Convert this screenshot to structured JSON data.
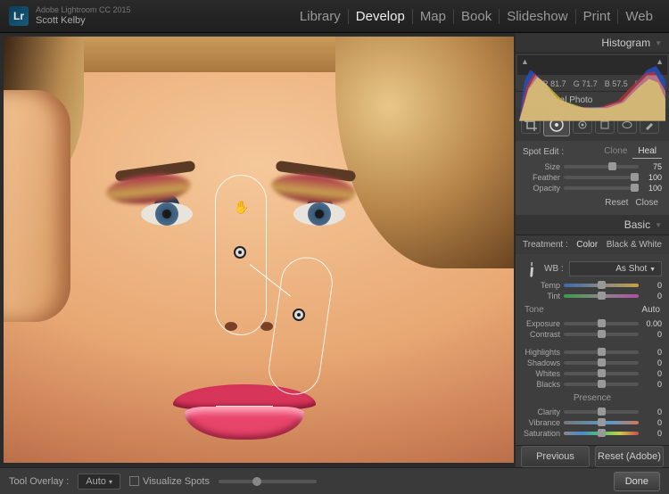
{
  "app": {
    "title": "Adobe Lightroom CC 2015",
    "user": "Scott Kelby",
    "logo": "Lr"
  },
  "modules": {
    "items": [
      "Library",
      "Develop",
      "Map",
      "Book",
      "Slideshow",
      "Print",
      "Web"
    ],
    "active": "Develop"
  },
  "histogram": {
    "title": "Histogram",
    "readout": {
      "r_label": "R",
      "r": "81.7",
      "g_label": "G",
      "g": "71.7",
      "b_label": "B",
      "b": "57.5",
      "pct": "%"
    },
    "original_label": "Original Photo"
  },
  "spot": {
    "label": "Spot Edit :",
    "modes": {
      "clone": "Clone",
      "heal": "Heal",
      "active": "Heal"
    },
    "size": {
      "label": "Size",
      "value": "75",
      "pos": 60
    },
    "feather": {
      "label": "Feather",
      "value": "100",
      "pos": 100
    },
    "opacity": {
      "label": "Opacity",
      "value": "100",
      "pos": 100
    },
    "reset": "Reset",
    "close": "Close"
  },
  "basic": {
    "title": "Basic",
    "treatment": {
      "label": "Treatment :",
      "color": "Color",
      "bw": "Black & White"
    },
    "wb": {
      "label": "WB :",
      "value": "As Shot"
    },
    "temp": {
      "label": "Temp",
      "value": "0",
      "pos": 50
    },
    "tint": {
      "label": "Tint",
      "value": "0",
      "pos": 50
    },
    "tone_label": "Tone",
    "auto": "Auto",
    "exposure": {
      "label": "Exposure",
      "value": "0.00",
      "pos": 50
    },
    "contrast": {
      "label": "Contrast",
      "value": "0",
      "pos": 50
    },
    "highlights": {
      "label": "Highlights",
      "value": "0",
      "pos": 50
    },
    "shadows": {
      "label": "Shadows",
      "value": "0",
      "pos": 50
    },
    "whites": {
      "label": "Whites",
      "value": "0",
      "pos": 50
    },
    "blacks": {
      "label": "Blacks",
      "value": "0",
      "pos": 50
    },
    "presence_label": "Presence",
    "clarity": {
      "label": "Clarity",
      "value": "0",
      "pos": 50
    },
    "vibrance": {
      "label": "Vibrance",
      "value": "0",
      "pos": 50
    },
    "saturation": {
      "label": "Saturation",
      "value": "0",
      "pos": 50
    }
  },
  "bottombar": {
    "tool_overlay_label": "Tool Overlay :",
    "tool_overlay_value": "Auto",
    "visualize_label": "Visualize Spots",
    "done": "Done"
  },
  "footer": {
    "previous": "Previous",
    "reset": "Reset (Adobe)"
  }
}
